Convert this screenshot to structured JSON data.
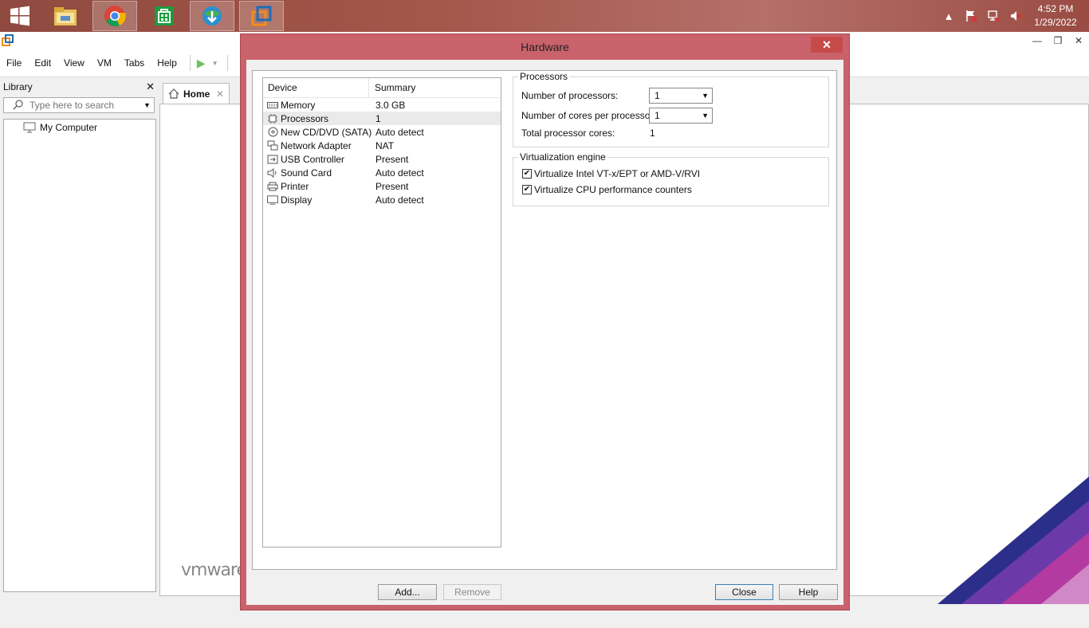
{
  "taskbar": {
    "start_icon": "windows-logo-icon",
    "pinned": [
      {
        "name": "file-explorer-icon"
      },
      {
        "name": "chrome-icon"
      },
      {
        "name": "store-icon"
      },
      {
        "name": "download-manager-icon"
      },
      {
        "name": "vmware-icon"
      }
    ],
    "clock_time": "4:52 PM",
    "clock_date": "1/29/2022"
  },
  "app": {
    "menu": [
      "File",
      "Edit",
      "View",
      "VM",
      "Tabs",
      "Help"
    ],
    "library": {
      "title": "Library",
      "search_placeholder": "Type here to search",
      "tree": [
        "My Computer"
      ]
    },
    "home_tab": "Home",
    "vmware_logo": "vmware"
  },
  "dialog": {
    "title": "Hardware",
    "columns": {
      "device": "Device",
      "summary": "Summary"
    },
    "devices": [
      {
        "name": "Memory",
        "summary": "3.0 GB",
        "icon": "memory-icon"
      },
      {
        "name": "Processors",
        "summary": "1",
        "icon": "processor-icon",
        "selected": true
      },
      {
        "name": "New CD/DVD (SATA)",
        "summary": "Auto detect",
        "icon": "cd-dvd-icon"
      },
      {
        "name": "Network Adapter",
        "summary": "NAT",
        "icon": "network-adapter-icon"
      },
      {
        "name": "USB Controller",
        "summary": "Present",
        "icon": "usb-controller-icon"
      },
      {
        "name": "Sound Card",
        "summary": "Auto detect",
        "icon": "sound-card-icon"
      },
      {
        "name": "Printer",
        "summary": "Present",
        "icon": "printer-icon"
      },
      {
        "name": "Display",
        "summary": "Auto detect",
        "icon": "display-icon"
      }
    ],
    "add_button": "Add...",
    "remove_button": "Remove",
    "processors_group": {
      "title": "Processors",
      "num_processors_label": "Number of processors:",
      "num_processors_value": "1",
      "cores_label": "Number of cores per processor:",
      "cores_value": "1",
      "total_label": "Total processor cores:",
      "total_value": "1"
    },
    "virtualization_group": {
      "title": "Virtualization engine",
      "option1": "Virtualize Intel VT-x/EPT or AMD-V/RVI",
      "option2": "Virtualize CPU performance counters",
      "option1_checked": true,
      "option2_checked": true
    },
    "close_button": "Close",
    "help_button": "Help"
  }
}
